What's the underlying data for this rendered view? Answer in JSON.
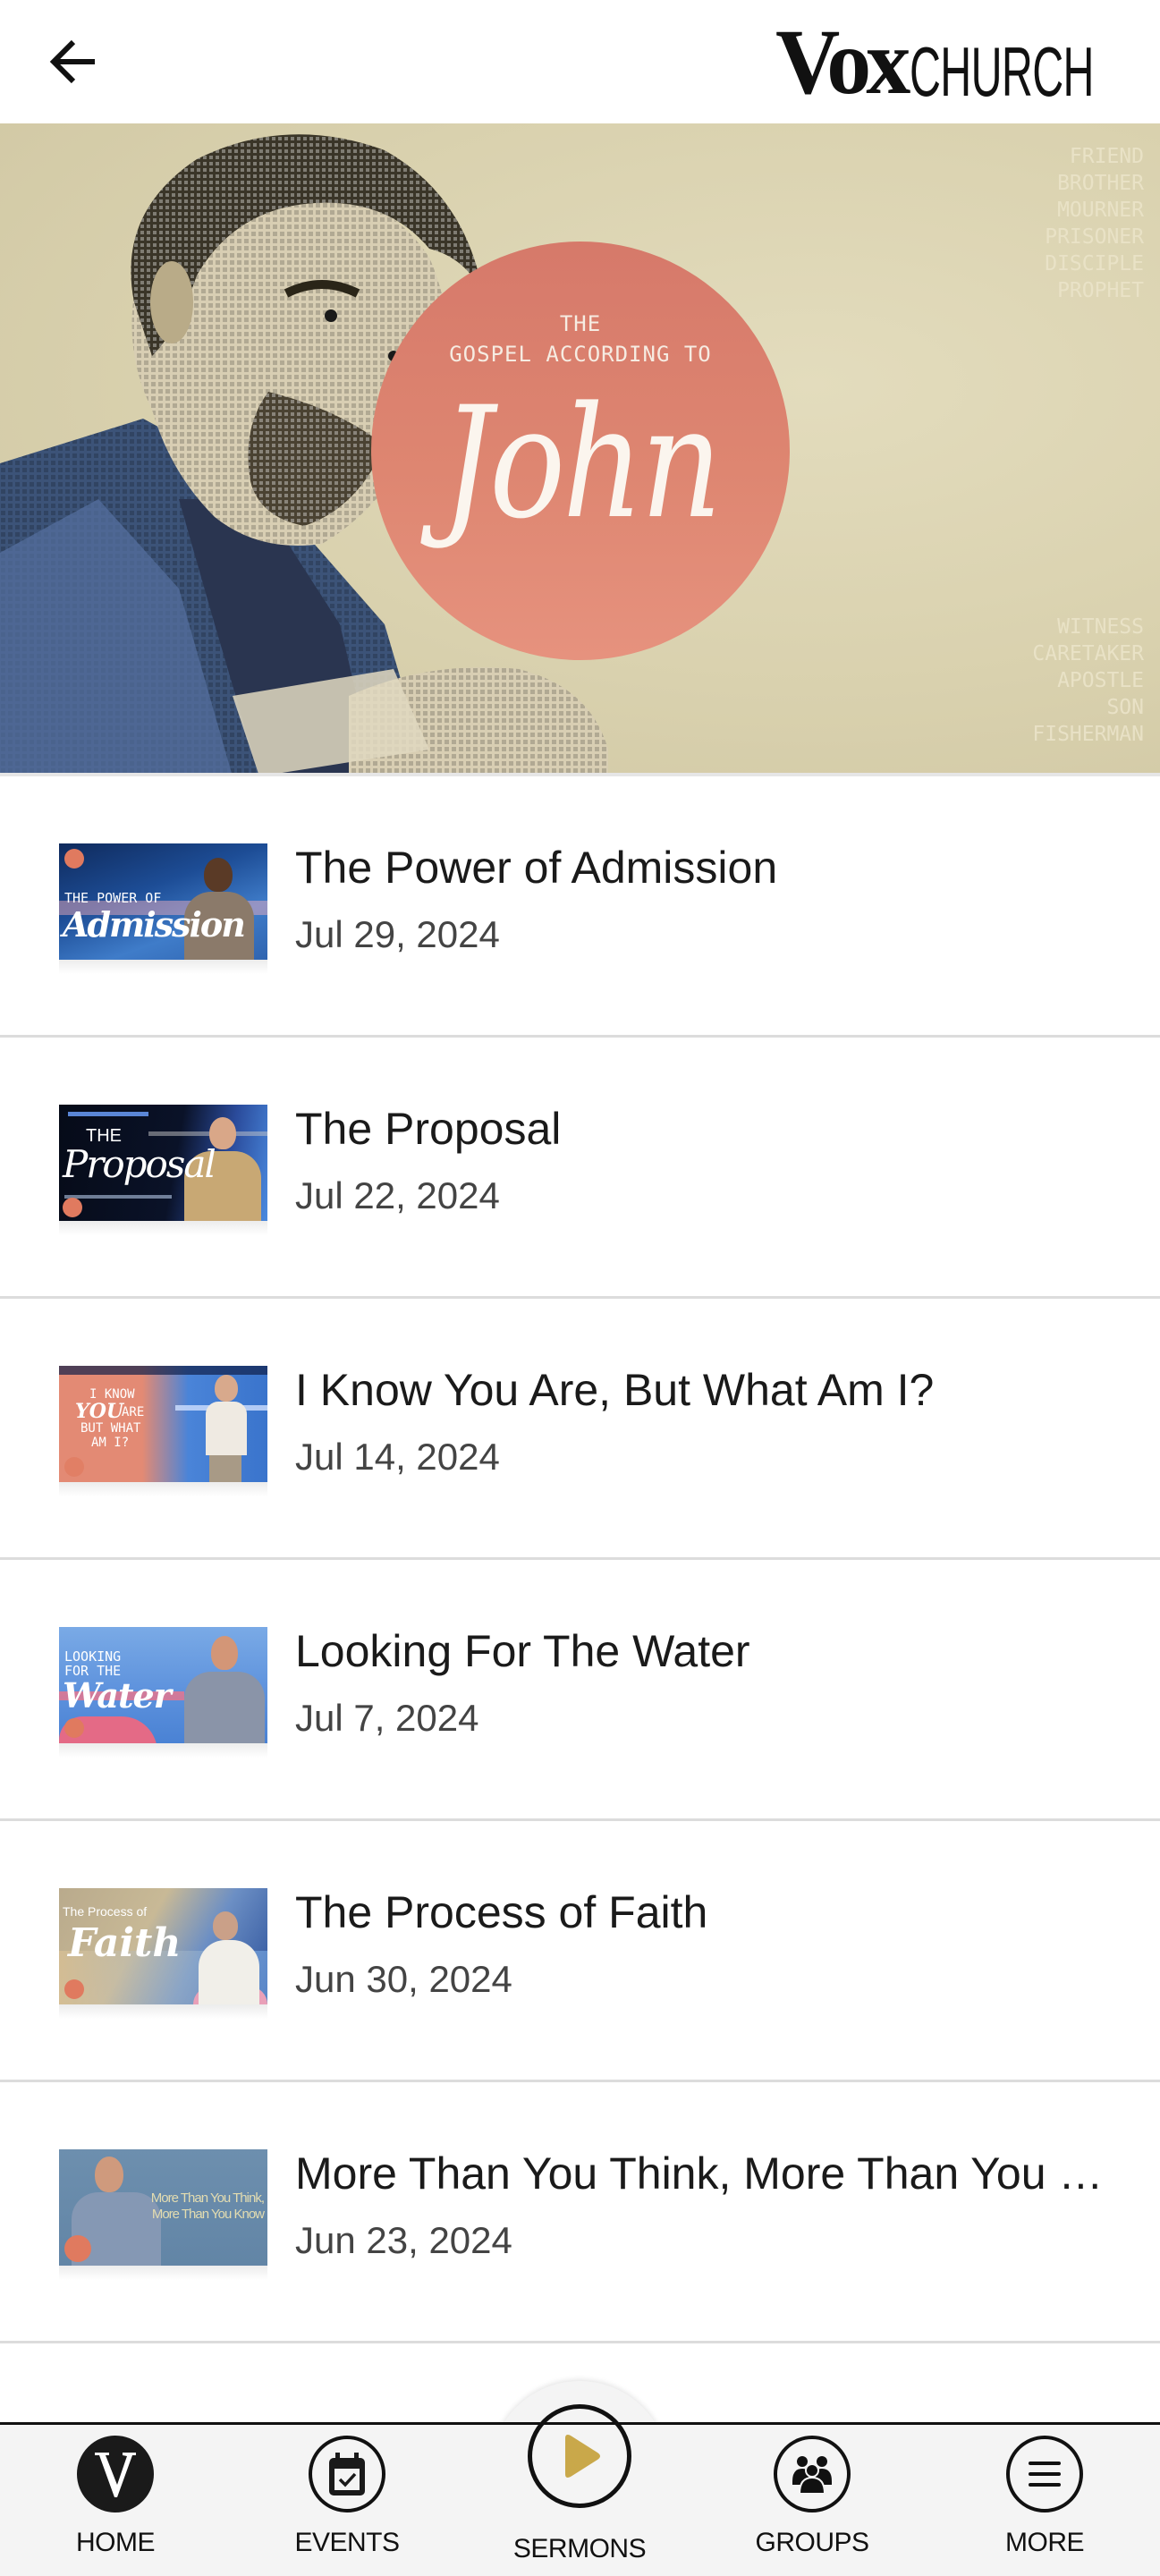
{
  "header": {
    "back_icon": "arrow-left-icon",
    "logo_primary": "Vox",
    "logo_secondary": "CHURCH"
  },
  "hero": {
    "line1": "THE",
    "line2": "GOSPEL ACCORDING TO",
    "title": "John",
    "side_words_top": [
      "FRIEND",
      "BROTHER",
      "MOURNER",
      "PRISONER",
      "DISCIPLE",
      "PROPHET"
    ],
    "side_words_bottom": [
      "WITNESS",
      "CARETAKER",
      "APOSTLE",
      "SON",
      "FISHERMAN"
    ],
    "colors": {
      "circle": "#d97b66",
      "background": "#d9d2b2"
    }
  },
  "sermons": [
    {
      "title": "The Power of Admission",
      "date": "Jul 29, 2024",
      "thumb_line1": "THE POWER OF",
      "thumb_script": "Admission"
    },
    {
      "title": "The Proposal",
      "date": "Jul 22, 2024",
      "thumb_line1": "THE",
      "thumb_script": "Proposal"
    },
    {
      "title": "I Know You Are, But What Am I?",
      "date": "Jul 14, 2024",
      "thumb_line1": "I KNOW",
      "thumb_script": "YOU",
      "thumb_line2": "ARE",
      "thumb_line3": "BUT WHAT",
      "thumb_line4": "AM I?"
    },
    {
      "title": "Looking For The Water",
      "date": "Jul 7, 2024",
      "thumb_line1": "LOOKING",
      "thumb_line2": "FOR THE",
      "thumb_script": "Water"
    },
    {
      "title": "The Process of Faith",
      "date": "Jun 30, 2024",
      "thumb_line1": "The Process of",
      "thumb_script": "Faith"
    },
    {
      "title": "More Than You Think, More Than You Know",
      "date": "Jun 23, 2024",
      "thumb_line1": "More Than You Think,",
      "thumb_line2": "More Than You Know"
    }
  ],
  "nav": {
    "items": [
      {
        "label": "HOME",
        "icon": "v-logo-icon"
      },
      {
        "label": "EVENTS",
        "icon": "calendar-check-icon"
      },
      {
        "label": "SERMONS",
        "icon": "play-icon",
        "active": true
      },
      {
        "label": "GROUPS",
        "icon": "people-icon"
      },
      {
        "label": "MORE",
        "icon": "menu-icon"
      }
    ],
    "accent_color": "#c9a84a"
  }
}
